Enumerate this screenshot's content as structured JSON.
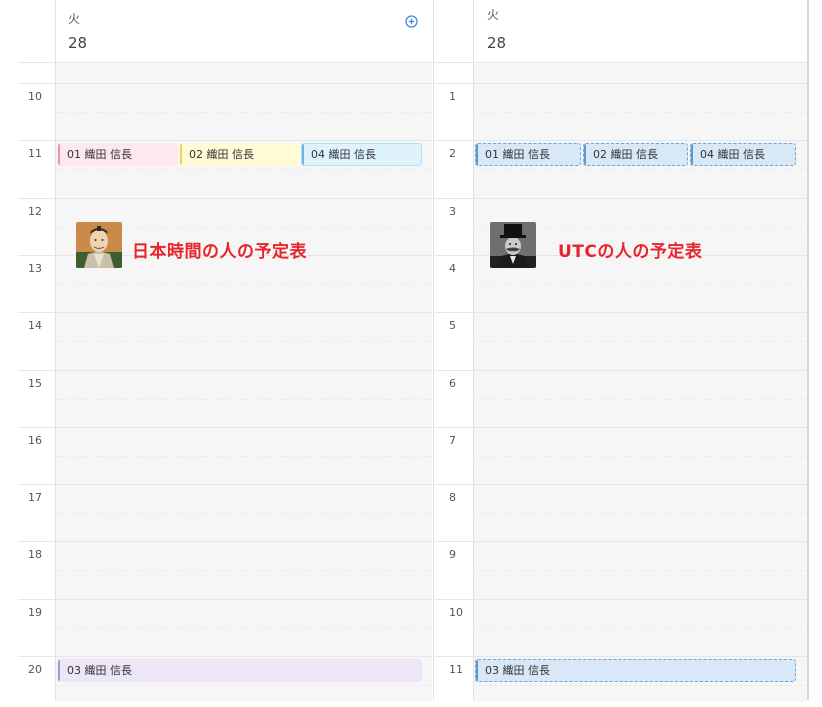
{
  "left": {
    "day_name": "火",
    "day_number": "28",
    "hours": [
      "10",
      "11",
      "12",
      "13",
      "14",
      "15",
      "16",
      "17",
      "18",
      "19",
      "20"
    ],
    "events": [
      {
        "label": "01 織田 信長",
        "color": "pink"
      },
      {
        "label": "02 織田 信長",
        "color": "yellow"
      },
      {
        "label": "04 織田 信長",
        "color": "cyan"
      },
      {
        "label": "03 織田 信長",
        "color": "lavender"
      }
    ],
    "annotation": "日本時間の人の予定表",
    "portrait_icon": "samurai-portrait-icon"
  },
  "right": {
    "day_name": "火",
    "day_number": "28",
    "hours": [
      "1",
      "2",
      "3",
      "4",
      "5",
      "6",
      "7",
      "8",
      "9",
      "10",
      "11"
    ],
    "events": [
      {
        "label": "01 織田 信長"
      },
      {
        "label": "02 織田 信長"
      },
      {
        "label": "04 織田 信長"
      },
      {
        "label": "03 織田 信長"
      }
    ],
    "annotation": "UTCの人の予定表",
    "portrait_icon": "top-hat-man-portrait-icon"
  },
  "colors": {
    "annotation_text": "#e8242b",
    "add_icon": "#3a86d6",
    "utc_event_fill": "#d8e8f6",
    "utc_event_border": "#6ea5d5"
  },
  "icons": {
    "add_event": "add-event-icon"
  }
}
